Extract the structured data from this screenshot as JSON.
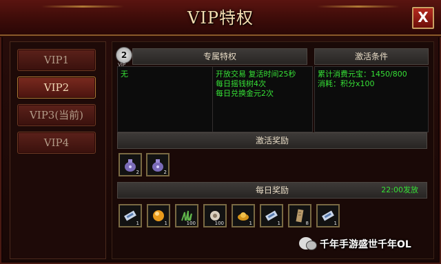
{
  "window": {
    "title": "VIP特权",
    "close_label": "X"
  },
  "vip_tabs": [
    {
      "label": "VIP1",
      "active": false
    },
    {
      "label": "VIP2",
      "active": true
    },
    {
      "label": "VIP3(当前)",
      "active": false
    },
    {
      "label": "VIP4",
      "active": false
    }
  ],
  "badge": {
    "number": "2",
    "sub": "VIP"
  },
  "privileges": {
    "header": "专属特权",
    "left_text": "无",
    "lines": [
      "开放交易  复活时间25秒",
      "每日摇钱树4次",
      "每日兑换金元2次"
    ]
  },
  "activation": {
    "header": "激活条件",
    "lines": [
      "累计消费元宝：1450/800",
      "消耗：积分x100"
    ]
  },
  "activation_reward": {
    "header": "激活奖励",
    "items": [
      {
        "icon": "purple-bag-icon",
        "count": "2"
      },
      {
        "icon": "purple-bag-icon",
        "count": "2"
      }
    ]
  },
  "daily_reward": {
    "header": "每日奖励",
    "time": "22:00发放",
    "items": [
      {
        "icon": "ticket-icon",
        "count": "1"
      },
      {
        "icon": "gold-orb-icon",
        "count": "1"
      },
      {
        "icon": "herb-icon",
        "count": "100"
      },
      {
        "icon": "pouch-icon",
        "count": "100"
      },
      {
        "icon": "gold-ingot-icon",
        "count": "1"
      },
      {
        "icon": "ticket-icon",
        "count": "1"
      },
      {
        "icon": "scroll-icon",
        "count": "8"
      },
      {
        "icon": "ticket-icon",
        "count": "1"
      }
    ]
  },
  "watermark": {
    "text": "千年手游盛世千年OL"
  },
  "colors": {
    "accent_green": "#36e036",
    "title_gold": "#f3dcb0",
    "frame_red": "#5a1410"
  }
}
